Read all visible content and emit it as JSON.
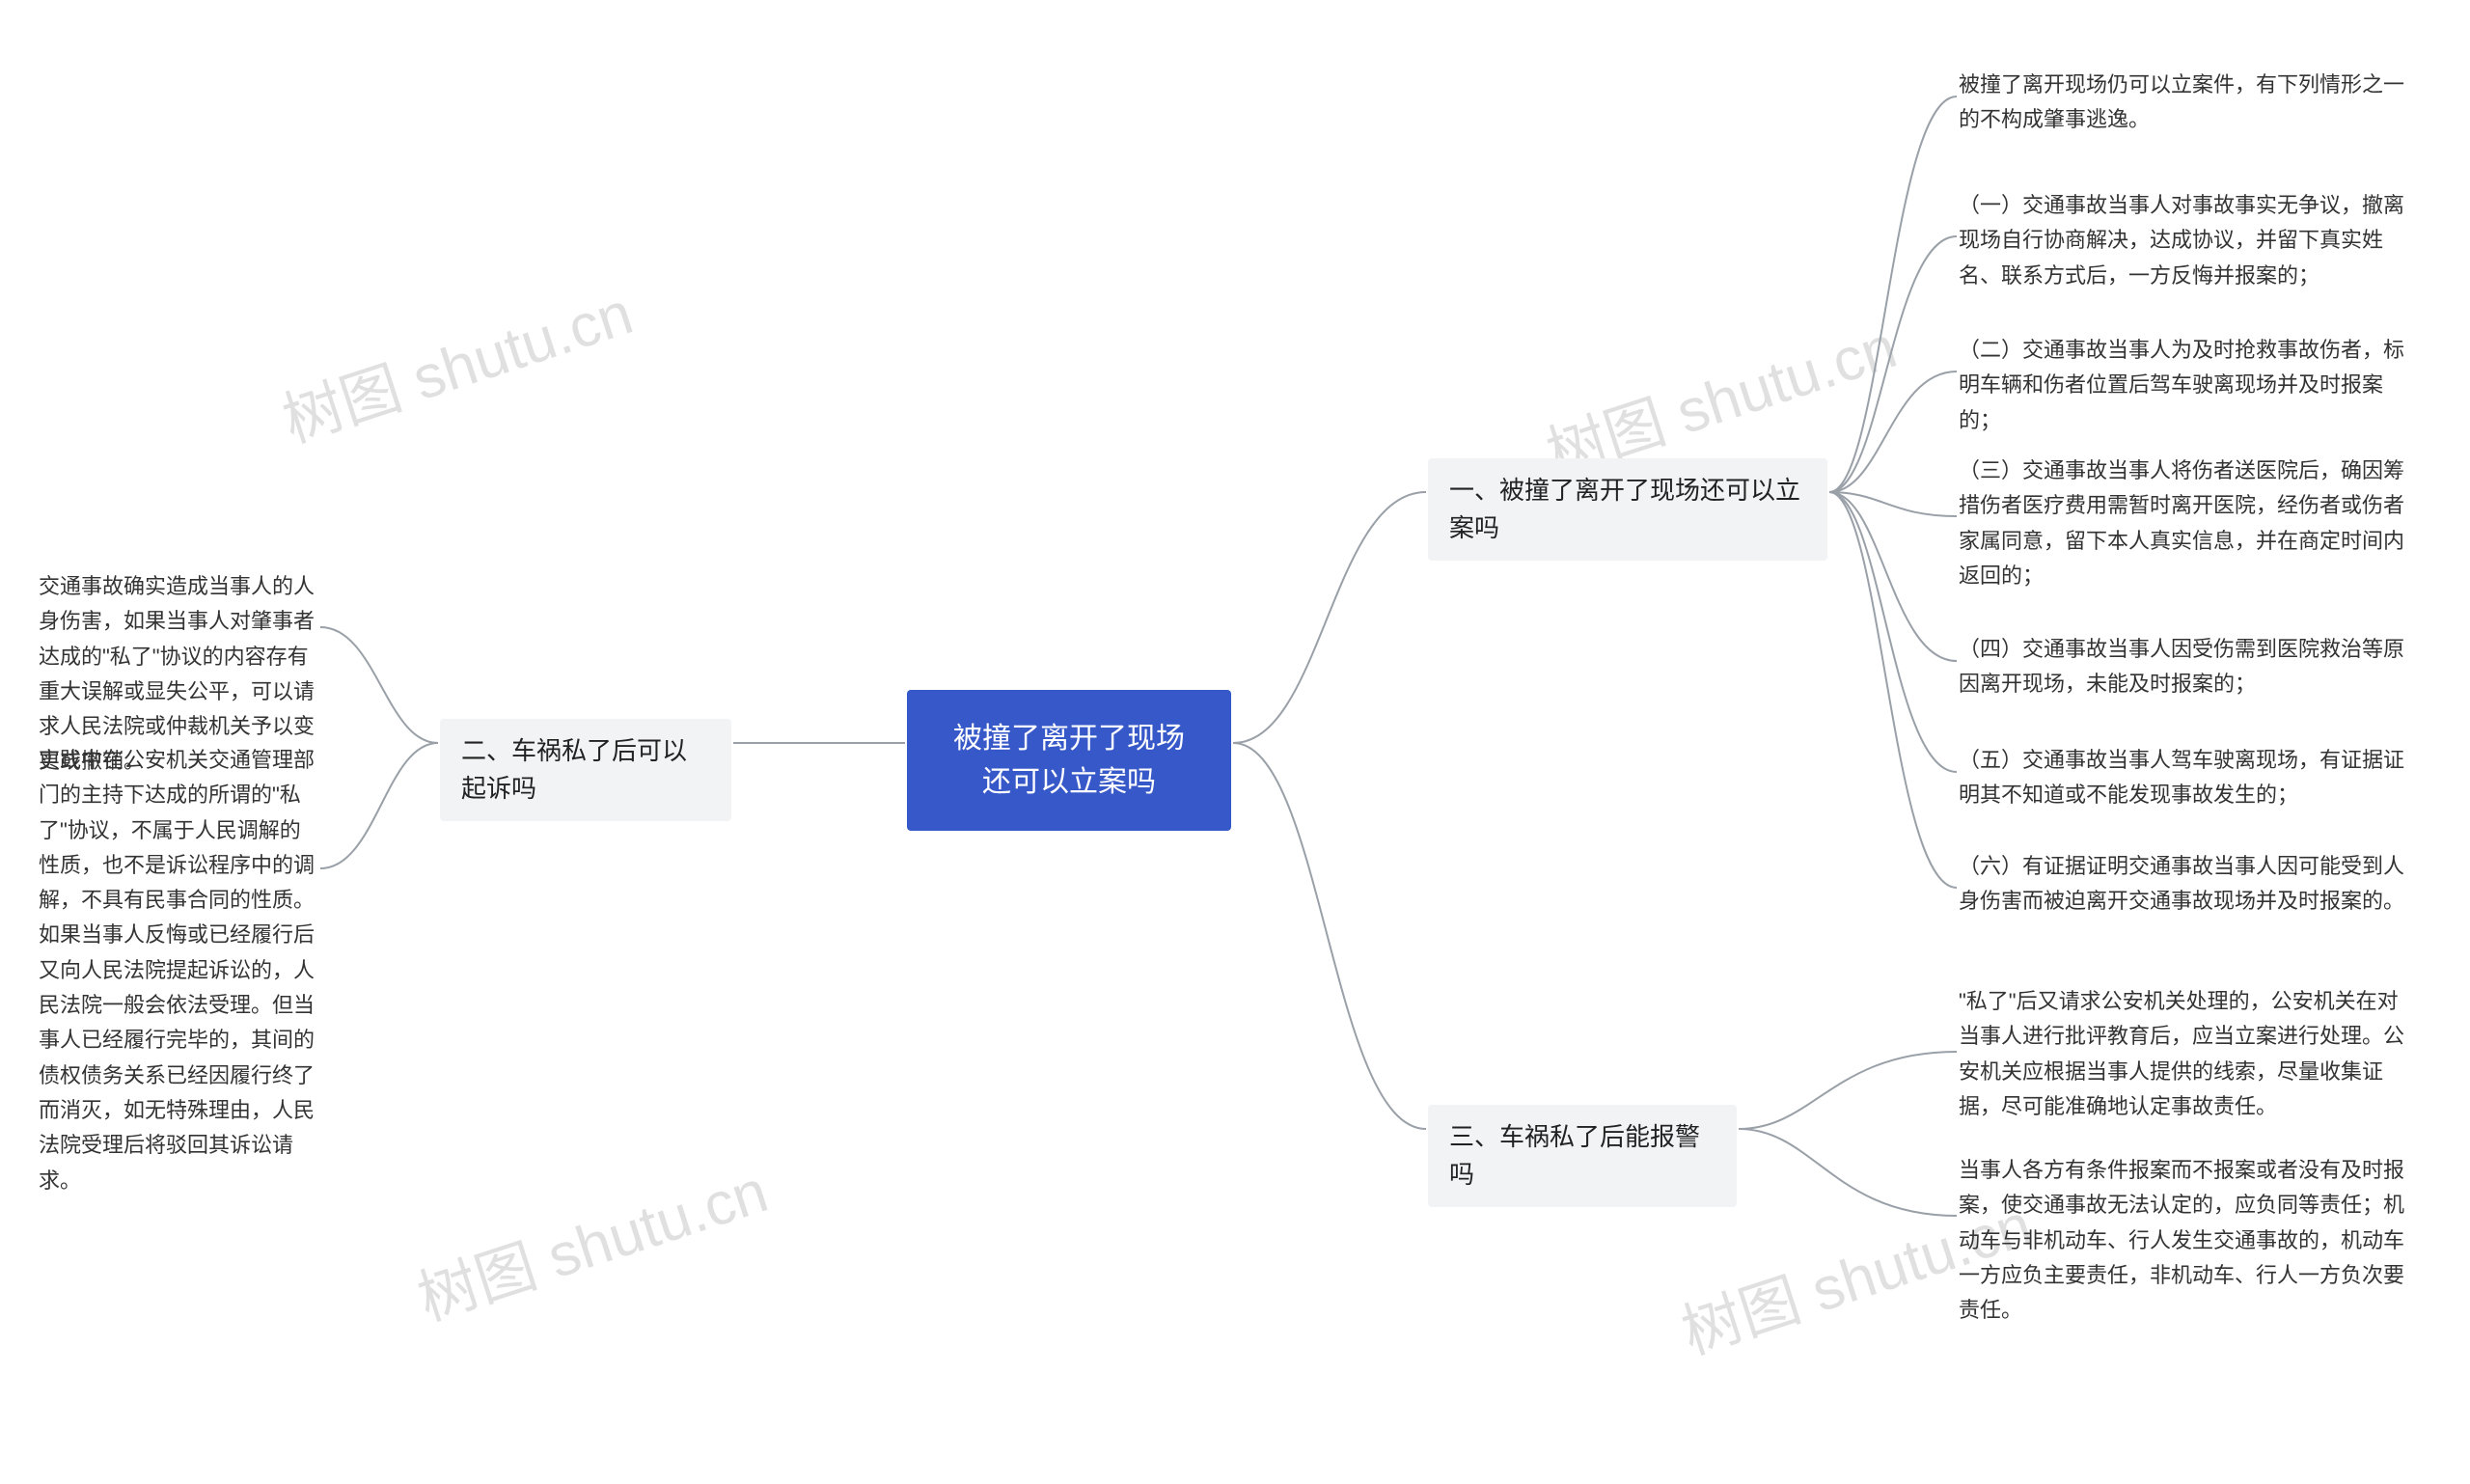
{
  "watermark": "树图 shutu.cn",
  "central": "被撞了离开了现场还可以立案吗",
  "right": {
    "branch1": {
      "title": "一、被撞了离开了现场还可以立案吗",
      "items": [
        "被撞了离开现场仍可以立案件，有下列情形之一的不构成肇事逃逸。",
        "（一）交通事故当事人对事故事实无争议，撤离现场自行协商解决，达成协议，并留下真实姓名、联系方式后，一方反悔并报案的；",
        "（二）交通事故当事人为及时抢救事故伤者，标明车辆和伤者位置后驾车驶离现场并及时报案的；",
        "（三）交通事故当事人将伤者送医院后，确因筹措伤者医疗费用需暂时离开医院，经伤者或伤者家属同意，留下本人真实信息，并在商定时间内返回的；",
        "（四）交通事故当事人因受伤需到医院救治等原因离开现场，未能及时报案的；",
        "（五）交通事故当事人驾车驶离现场，有证据证明其不知道或不能发现事故发生的；",
        "（六）有证据证明交通事故当事人因可能受到人身伤害而被迫离开交通事故现场并及时报案的。"
      ]
    },
    "branch3": {
      "title": "三、车祸私了后能报警吗",
      "items": [
        "\"私了\"后又请求公安机关处理的，公安机关在对当事人进行批评教育后，应当立案进行处理。公安机关应根据当事人提供的线索，尽量收集证据，尽可能准确地认定事故责任。",
        "当事人各方有条件报案而不报案或者没有及时报案，使交通事故无法认定的，应负同等责任；机动车与非机动车、行人发生交通事故的，机动车一方应负主要责任，非机动车、行人一方负次要责任。"
      ]
    }
  },
  "left": {
    "branch2": {
      "title": "二、车祸私了后可以起诉吗",
      "items": [
        "交通事故确实造成当事人的人身伤害，如果当事人对肇事者达成的\"私了\"协议的内容存有重大误解或显失公平，可以请求人民法院或仲裁机关予以变更或撤销。",
        "实践中在公安机关交通管理部门的主持下达成的所谓的\"私了\"协议，不属于人民调解的性质，也不是诉讼程序中的调解，不具有民事合同的性质。如果当事人反悔或已经履行后又向人民法院提起诉讼的，人民法院一般会依法受理。但当事人已经履行完毕的，其间的债权债务关系已经因履行终了而消灭，如无特殊理由，人民法院受理后将驳回其诉讼请求。"
      ]
    }
  }
}
